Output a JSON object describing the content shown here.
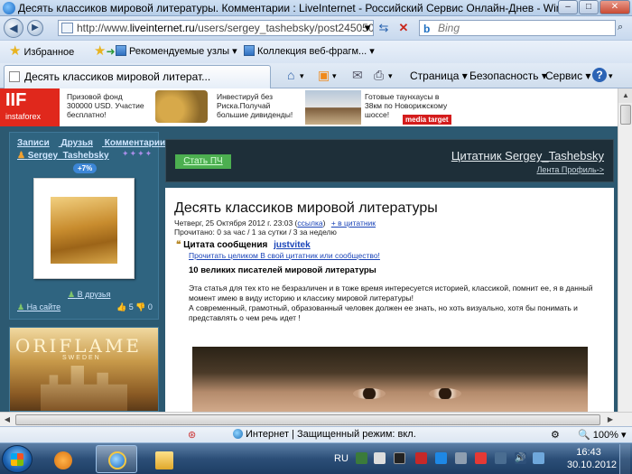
{
  "window": {
    "title": "Десять классиков мировой литературы. Комментарии : LiveInternet - Российский Сервис Онлайн-Днев - Windows Internet E...",
    "minimize": "–",
    "maximize": "□",
    "close": "✕"
  },
  "address": {
    "url_prefix": "http://www.",
    "url_domain": "liveinternet.ru",
    "url_path": "/users/sergey_tashebsky/post245050981/",
    "search_placeholder": "Bing",
    "search_logo": "b"
  },
  "favorites": {
    "favorites_label": "Избранное",
    "suggested_label": "Рекомендуемые узлы ▾",
    "gallery_label": "Коллекция веб-фрагм... ▾"
  },
  "tab": {
    "title": "Десять классиков мировой литерат..."
  },
  "commands": {
    "page": "Страница ▾",
    "security": "Безопасность ▾",
    "service": "Сервис ▾",
    "help": "?"
  },
  "ads": {
    "logo_big": "IIF",
    "logo_small": "instaforex",
    "ad1_text": "Призовой фонд 300000 USD. Участие бесплатно!",
    "ad2_text": "Инвестируй без Риска.Получай большие дивиденды!",
    "ad3_text": "Готовые таунхаусы в 38км по Новорижскому шоссе!",
    "ad3_badge": "media target"
  },
  "sidebar": {
    "links": [
      "Записи",
      "Друзья",
      "Комментарии"
    ],
    "username": "Sergey_Tashebsky",
    "stars": "✦✦✦✦",
    "rating_badge": "+7%",
    "friends_link": "В друзья",
    "online_link": "На сайте",
    "likes": "👍 5  👎 0"
  },
  "oriflame": {
    "title": "ORIFLAME",
    "subtitle": "SWEDEN"
  },
  "blog_header": {
    "stat_button": "Стать ПЧ",
    "title": "Цитатник Sergey_Tashebsky",
    "sub_links": "Лента Профиль->"
  },
  "post": {
    "title": "Десять классиков мировой литературы",
    "meta_date": "Четверг, 25 Октября 2012 г. 23:03 (",
    "meta_link": "ссылка",
    "meta_close": ")",
    "meta_quote": "+ в цитатник",
    "read_stats": "Прочитано: 0 за час / 1 за сутки / 3 за неделю",
    "quote_label": "Цитата сообщения",
    "quote_author": "justvitek",
    "quote_links": "Прочитать целиком В свой цитатник или сообщество!",
    "heading": "10 великих писателей мировой литературы",
    "body_p1": "Эта статья для тех кто не безразличен и в тоже время интересуется историей, классикой, помнит ее, я в данный момент имею в виду историю и классику мировой литературы!",
    "body_p2": "А современный, грамотный, образованный человек должен ее знать, но хоть визуально, хотя бы понимать и представлять о чем речь идет !"
  },
  "status": {
    "zone": "Интернет | Защищенный режим: вкл.",
    "zoom": "100%"
  },
  "taskbar": {
    "lang": "RU",
    "time": "16:43",
    "date": "30.10.2012"
  }
}
